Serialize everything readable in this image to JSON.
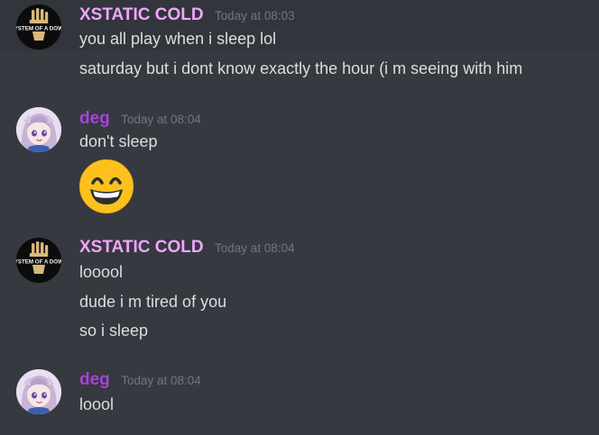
{
  "messages": [
    {
      "author": "XSTATIC COLD",
      "timestamp": "Today at 08:03",
      "lines": [
        "you all play when i sleep lol",
        "saturday but i dont know exactly the hour (i m seeing with him"
      ]
    },
    {
      "author": "deg",
      "timestamp": "Today at 08:04",
      "lines": [
        "don't sleep"
      ],
      "emoji": "grinning-face-with-smiling-eyes"
    },
    {
      "author": "XSTATIC COLD",
      "timestamp": "Today at 08:04",
      "lines": [
        "looool",
        "dude i m tired of you",
        "so i sleep"
      ]
    },
    {
      "author": "deg",
      "timestamp": "Today at 08:04",
      "lines": [
        "loool"
      ]
    }
  ],
  "avatars": {
    "xstatic": {
      "band_text": "SYSTEM OF A DOWN",
      "colors": {
        "background": "#0c0c0c",
        "hand": "#d9b87a"
      }
    },
    "deg": {
      "colors": {
        "hair": "#c9b3d6",
        "eyes": "#6a4ea3"
      }
    }
  },
  "colors": {
    "background": "#36393f",
    "hover_background": "#32353b",
    "text": "#dcddde",
    "timestamp": "#72767d",
    "xstatic_name": "#f1a5ff",
    "deg_name": "#a844d8"
  }
}
